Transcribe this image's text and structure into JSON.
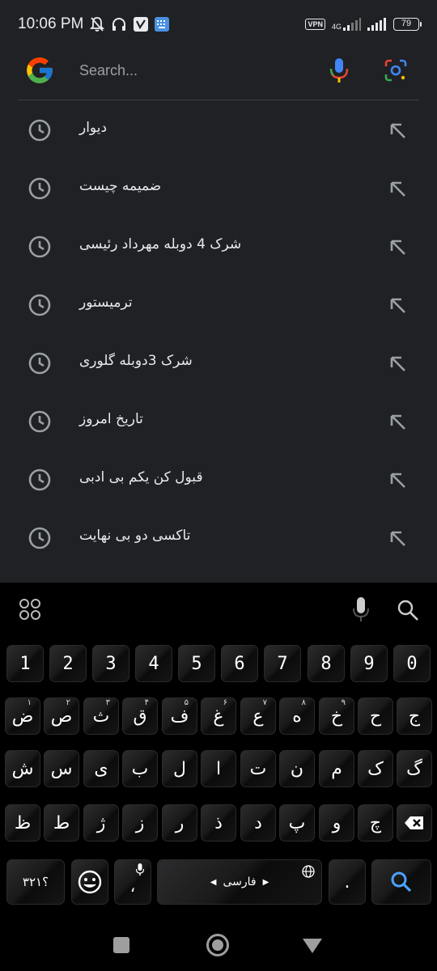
{
  "status_bar": {
    "time": "10:06 PM",
    "vpn_label": "VPN",
    "network_label": "4G",
    "battery_level": "79",
    "icons": [
      "mute-bell-icon",
      "headphones-icon",
      "app-v-icon",
      "keyboard-icon"
    ]
  },
  "search": {
    "placeholder": "Search...",
    "value": ""
  },
  "suggestions": [
    {
      "text": "دیوار"
    },
    {
      "text": "ضمیمه چیست"
    },
    {
      "text": "شرک 4 دوبله مهرداد رئیسی"
    },
    {
      "text": "ترمیستور"
    },
    {
      "text": "شرک 3دوبله گلوری"
    },
    {
      "text": "تاریخ امروز"
    },
    {
      "text": "قبول کن یکم بی ادبی"
    },
    {
      "text": "تاکسی دو بی نهایت"
    }
  ],
  "keyboard": {
    "row_numbers": [
      "1",
      "2",
      "3",
      "4",
      "5",
      "6",
      "7",
      "8",
      "9",
      "0"
    ],
    "row1": [
      {
        "label": "ض",
        "hint": "۱"
      },
      {
        "label": "ص",
        "hint": "۲"
      },
      {
        "label": "ث",
        "hint": "۳"
      },
      {
        "label": "ق",
        "hint": "۴"
      },
      {
        "label": "ف",
        "hint": "۵"
      },
      {
        "label": "غ",
        "hint": "۶"
      },
      {
        "label": "ع",
        "hint": "۷"
      },
      {
        "label": "ه",
        "hint": "۸"
      },
      {
        "label": "خ",
        "hint": "۹"
      },
      {
        "label": "ح",
        "hint": ""
      },
      {
        "label": "ج",
        "hint": ""
      }
    ],
    "row2": [
      "ش",
      "س",
      "ی",
      "ب",
      "ل",
      "ا",
      "ت",
      "ن",
      "م",
      "ک",
      "گ"
    ],
    "row3": [
      "ظ",
      "ط",
      "ژ",
      "ز",
      "ر",
      "ذ",
      "د",
      "پ",
      "و",
      "چ"
    ],
    "symbols_label": "؟۳۲۱",
    "comma_label": "،",
    "space_label": "فارسی",
    "period_label": "."
  },
  "colors": {
    "background": "#202124",
    "text": "#e8eaed",
    "accent": "#8ab4f8",
    "keyboard_bg": "#000000"
  }
}
